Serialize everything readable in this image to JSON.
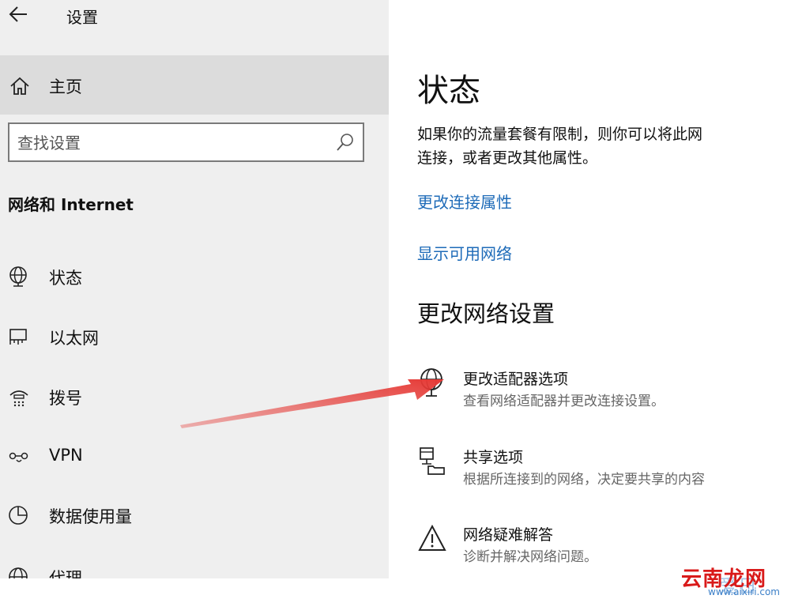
{
  "header": {
    "app_title": "设置",
    "back_icon": "back-arrow-icon"
  },
  "sidebar": {
    "home_label": "主页",
    "search_placeholder": "查找设置",
    "section_heading": "网络和 Internet",
    "items": [
      {
        "label": "状态",
        "icon": "globe-monitor-icon"
      },
      {
        "label": "以太网",
        "icon": "ethernet-icon"
      },
      {
        "label": "拨号",
        "icon": "dialup-icon"
      },
      {
        "label": "VPN",
        "icon": "vpn-icon"
      },
      {
        "label": "数据使用量",
        "icon": "data-usage-icon"
      },
      {
        "label": "代理",
        "icon": "proxy-globe-icon"
      }
    ]
  },
  "main": {
    "title": "状态",
    "description_line1": "如果你的流量套餐有限制，则你可以将此网",
    "description_line2": "连接，或者更改其他属性。",
    "links": {
      "change_connection_properties": "更改连接属性",
      "show_available_networks": "显示可用网络"
    },
    "section_heading": "更改网络设置",
    "options": [
      {
        "title": "更改适配器选项",
        "subtitle": "查看网络适配器并更改连接设置。",
        "icon": "globe-adapter-icon"
      },
      {
        "title": "共享选项",
        "subtitle": "根据所连接到的网络，决定要共享的内容",
        "icon": "sharing-icon"
      },
      {
        "title": "网络疑难解答",
        "subtitle": "诊断并解决网络问题。",
        "icon": "warning-icon"
      }
    ]
  },
  "annotation": {
    "arrow_color": "#e53935"
  },
  "watermark": {
    "text": "云南龙网",
    "ghost": "爱日",
    "url": "www.aixiri.com"
  },
  "colors": {
    "sidebar_bg": "#efefef",
    "selected_bg": "#dcdcdc",
    "link": "#1e6bb8"
  }
}
